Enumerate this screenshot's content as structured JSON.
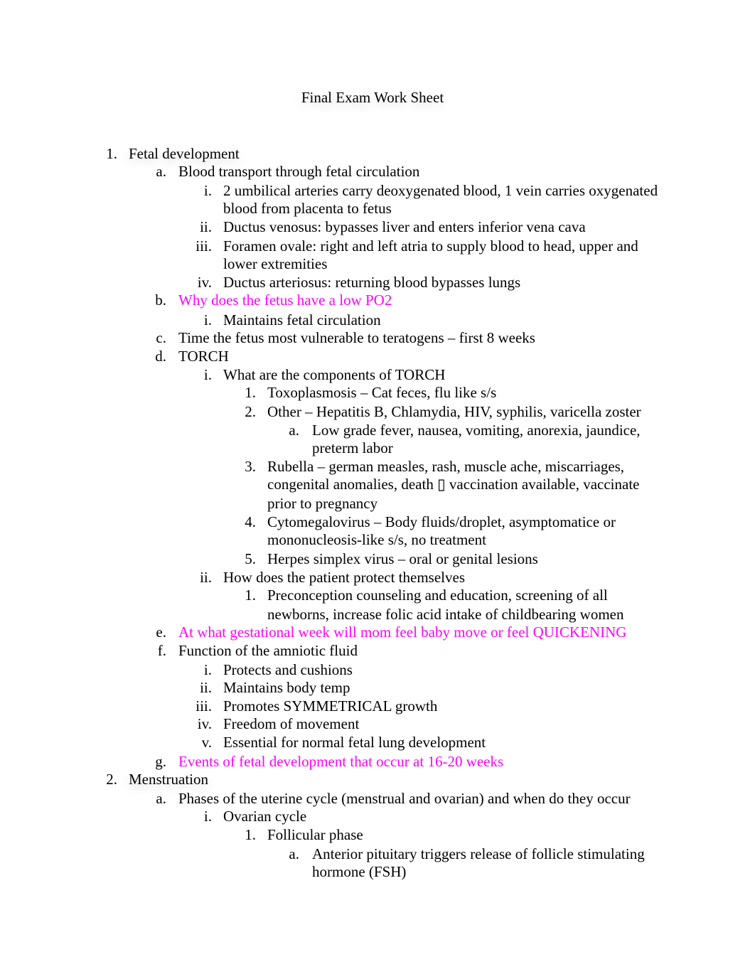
{
  "document": {
    "title": "Final Exam Work Sheet",
    "accent_color": "#ff00ff",
    "lines": [
      {
        "marker": "1.",
        "text": "Fetal development",
        "level": 0
      },
      {
        "marker": "a.",
        "text": "Blood transport through fetal circulation",
        "level": 1
      },
      {
        "marker": "i.",
        "text": "2 umbilical arteries carry deoxygenated blood, 1 vein carries oxygenated",
        "level": 2
      },
      {
        "marker": "",
        "text": "blood from placenta to fetus",
        "level": 2
      },
      {
        "marker": "ii.",
        "text": "Ductus venosus: bypasses liver and enters inferior vena cava",
        "level": 2
      },
      {
        "marker": "iii.",
        "text": "Foramen ovale: right and left atria to supply blood to head, upper and",
        "level": 2
      },
      {
        "marker": "",
        "text": "lower extremities",
        "level": 2
      },
      {
        "marker": "iv.",
        "text": "Ductus arteriosus: returning blood bypasses lungs",
        "level": 2
      },
      {
        "marker": "b.",
        "text": "Why does the fetus have a low PO2",
        "level": 1,
        "highlight": true
      },
      {
        "marker": "i.",
        "text": "Maintains fetal circulation",
        "level": 2
      },
      {
        "marker": "c.",
        "text": "Time the fetus most vulnerable to teratogens – first 8 weeks",
        "level": 1
      },
      {
        "marker": "d.",
        "text": "TORCH",
        "level": 1
      },
      {
        "marker": "i.",
        "text": "What are the components of TORCH",
        "level": 2
      },
      {
        "marker": "1.",
        "text": "Toxoplasmosis – Cat feces, flu like s/s",
        "level": 3
      },
      {
        "marker": "2.",
        "text": "Other – Hepatitis B, Chlamydia, HIV, syphilis, varicella zoster",
        "level": 3
      },
      {
        "marker": "a.",
        "text": "Low grade fever, nausea, vomiting, anorexia, jaundice,",
        "level": 4
      },
      {
        "marker": "",
        "text": "preterm labor",
        "level": 4
      },
      {
        "marker": "3.",
        "text": "Rubella – german measles, rash, muscle ache, miscarriages,",
        "level": 3
      },
      {
        "marker": "",
        "text": "congenital anomalies, death ▯   vaccination available, vaccinate",
        "level": 3
      },
      {
        "marker": "",
        "text": "prior to pregnancy",
        "level": 3
      },
      {
        "marker": "4.",
        "text": "Cytomegalovirus – Body fluids/droplet, asymptomatice or",
        "level": 3
      },
      {
        "marker": "",
        "text": "mononucleosis-like s/s, no treatment",
        "level": 3
      },
      {
        "marker": "5.",
        "text": "Herpes simplex virus – oral or genital lesions",
        "level": 3
      },
      {
        "marker": "ii.",
        "text": "How does the patient protect themselves",
        "level": 2
      },
      {
        "marker": "1.",
        "text": "Preconception counseling and education, screening of all",
        "level": 3
      },
      {
        "marker": "",
        "text": "newborns, increase folic acid intake of childbearing women",
        "level": 3
      },
      {
        "marker": "e.",
        "text": "At what gestational week will mom feel baby move or feel QUICKENING",
        "level": 1,
        "highlight": true
      },
      {
        "marker": "f.",
        "text": "Function of the amniotic fluid",
        "level": 1
      },
      {
        "marker": "i.",
        "text": "Protects and cushions",
        "level": 2
      },
      {
        "marker": "ii.",
        "text": "Maintains body temp",
        "level": 2
      },
      {
        "marker": "iii.",
        "text": "Promotes SYMMETRICAL growth",
        "level": 2
      },
      {
        "marker": "iv.",
        "text": "Freedom of movement",
        "level": 2
      },
      {
        "marker": "v.",
        "text": "Essential for normal fetal lung development",
        "level": 2
      },
      {
        "marker": "g.",
        "text": "Events of fetal development that occur at 16-20 weeks",
        "level": 1,
        "highlight": true
      },
      {
        "marker": "2.",
        "text": "Menstruation",
        "level": 0
      },
      {
        "marker": "a.",
        "text": "Phases of the uterine cycle (menstrual and ovarian) and when do they occur",
        "level": 1
      },
      {
        "marker": "i.",
        "text": "Ovarian cycle",
        "level": 2
      },
      {
        "marker": "1.",
        "text": "Follicular phase",
        "level": 3
      },
      {
        "marker": "a.",
        "text": "Anterior pituitary triggers release of follicle stimulating",
        "level": 4
      },
      {
        "marker": "",
        "text": "hormone (FSH)",
        "level": 4
      }
    ]
  }
}
